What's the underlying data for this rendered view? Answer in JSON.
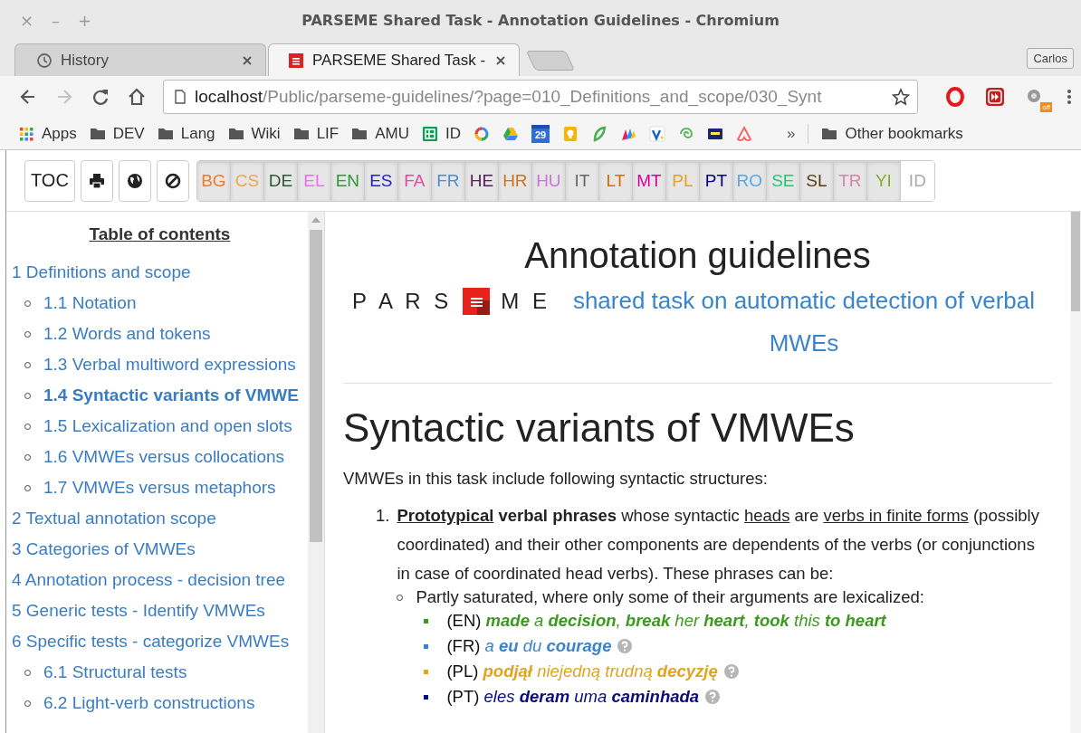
{
  "window": {
    "title": "PARSEME Shared Task - Annotation Guidelines - Chromium",
    "controls": [
      "×",
      "–",
      "+"
    ]
  },
  "tabs": [
    {
      "label": "History",
      "kind": "history",
      "selected": false
    },
    {
      "label": "PARSEME Shared Task -",
      "kind": "page",
      "selected": true
    }
  ],
  "profile": "Carlos",
  "nav_buttons": [
    {
      "kind": "back"
    },
    {
      "kind": "forward",
      "disabled": true
    },
    {
      "kind": "reload"
    },
    {
      "kind": "home"
    }
  ],
  "address": {
    "host": "localhost",
    "path": "/Public/parseme-guidelines/?page=010_Definitions_and_scope/030_Synt"
  },
  "extensions": [
    {
      "kind": "opera"
    },
    {
      "kind": "video"
    },
    {
      "kind": "plugin",
      "badge": "off"
    }
  ],
  "bookmarks": [
    {
      "kind": "apps",
      "label": "Apps"
    },
    {
      "kind": "folder",
      "label": "DEV"
    },
    {
      "kind": "folder",
      "label": "Lang"
    },
    {
      "kind": "folder",
      "label": "Wiki"
    },
    {
      "kind": "folder",
      "label": "LIF"
    },
    {
      "kind": "folder",
      "label": "AMU"
    },
    {
      "kind": "sheet",
      "label": "ID"
    },
    {
      "kind": "icon"
    },
    {
      "kind": "icon"
    },
    {
      "kind": "calendar",
      "label": "29"
    },
    {
      "kind": "icon"
    },
    {
      "kind": "icon"
    },
    {
      "kind": "icon"
    },
    {
      "kind": "icon"
    },
    {
      "kind": "icon"
    },
    {
      "kind": "icon"
    },
    {
      "kind": "icon"
    },
    {
      "kind": "more",
      "label": "»"
    }
  ],
  "other_bookmarks": "Other bookmarks",
  "tool_buttons": [
    {
      "kind": "text",
      "label": "TOC"
    },
    {
      "kind": "print"
    },
    {
      "kind": "globe"
    },
    {
      "kind": "ban"
    }
  ],
  "languages": [
    {
      "code": "BG",
      "color": "#f07a28",
      "selected": true
    },
    {
      "code": "CS",
      "color": "#f4a451",
      "selected": true
    },
    {
      "code": "DE",
      "color": "#2d5a33",
      "selected": true
    },
    {
      "code": "EL",
      "color": "#f06cf0",
      "selected": true
    },
    {
      "code": "EN",
      "color": "#2f9a2f",
      "selected": true
    },
    {
      "code": "ES",
      "color": "#2222c8",
      "selected": true
    },
    {
      "code": "FA",
      "color": "#f0449c",
      "selected": true
    },
    {
      "code": "FR",
      "color": "#4a90d0",
      "selected": true
    },
    {
      "code": "HE",
      "color": "#5a1a5a",
      "selected": true
    },
    {
      "code": "HR",
      "color": "#d07514",
      "selected": true
    },
    {
      "code": "HU",
      "color": "#c878d8",
      "selected": true
    },
    {
      "code": "IT",
      "color": "#666666",
      "selected": true
    },
    {
      "code": "LT",
      "color": "#d86a06",
      "selected": true
    },
    {
      "code": "MT",
      "color": "#d600a0",
      "selected": true
    },
    {
      "code": "PL",
      "color": "#e0a428",
      "selected": true
    },
    {
      "code": "PT",
      "color": "#000080",
      "selected": true
    },
    {
      "code": "RO",
      "color": "#58a8e8",
      "selected": true
    },
    {
      "code": "SE",
      "color": "#22c878",
      "selected": true
    },
    {
      "code": "SL",
      "color": "#5a3c10",
      "selected": true
    },
    {
      "code": "TR",
      "color": "#d884a8",
      "selected": true
    },
    {
      "code": "YI",
      "color": "#86a824",
      "selected": true
    },
    {
      "code": "ID",
      "color": "#aaaaaa",
      "selected": false
    }
  ],
  "toc": {
    "title": "Table of contents",
    "items": [
      {
        "label": "1 Definitions and scope",
        "selected": false,
        "children": [
          {
            "label": "1.1 Notation",
            "selected": false
          },
          {
            "label": "1.2 Words and tokens",
            "selected": false
          },
          {
            "label": "1.3 Verbal multiword expressions",
            "selected": false
          },
          {
            "label": "1.4 Syntactic variants of VMWE",
            "selected": true
          },
          {
            "label": "1.5 Lexicalization and open slots",
            "selected": false
          },
          {
            "label": "1.6 VMWEs versus collocations",
            "selected": false
          },
          {
            "label": "1.7 VMWEs versus metaphors",
            "selected": false
          }
        ]
      },
      {
        "label": "2 Textual annotation scope",
        "selected": false
      },
      {
        "label": "3 Categories of VMWEs",
        "selected": false
      },
      {
        "label": "4 Annotation process - decision tree",
        "selected": false
      },
      {
        "label": "5 Generic tests - Identify VMWEs",
        "selected": false
      },
      {
        "label": "6 Specific tests - categorize VMWEs",
        "selected": false,
        "children": [
          {
            "label": "6.1 Structural tests",
            "selected": false
          },
          {
            "label": "6.2 Light-verb constructions",
            "selected": false
          }
        ]
      }
    ]
  },
  "article": {
    "title": "Annotation guidelines",
    "logo": {
      "left": "P A R S",
      "right": "M E"
    },
    "subtitle_link": "shared task on automatic detection of verbal MWEs",
    "heading": "Syntactic variants of VMWEs",
    "intro": "VMWEs in this task include following syntactic structures:",
    "list": [
      {
        "number": "1.",
        "segments": [
          {
            "text": "Prototypical",
            "kind": "key_term"
          },
          {
            "text": " verbal phrases",
            "kind": "strong"
          },
          {
            "text": " whose syntactic ",
            "kind": "text"
          },
          {
            "text": "heads",
            "kind": "term"
          },
          {
            "text": " are ",
            "kind": "text"
          },
          {
            "text": "verbs in finite forms",
            "kind": "term"
          },
          {
            "text": " (possibly coordinated) and their other components are dependents of the verbs (or conjunctions in case of coordinated head verbs). These phrases can be:",
            "kind": "text"
          }
        ],
        "subitems": [
          {
            "text": "Partly saturated, where only some of their arguments are lexicalized:",
            "examples": [
              {
                "lang": "(EN)",
                "color": "#3a9a1e",
                "text": "**made** a **decision**, **break** her **heart**, **took** this **to heart**",
                "help": false
              },
              {
                "lang": "(FR)",
                "color": "#3a84cc",
                "text": "a **eu** du **courage**",
                "help": true
              },
              {
                "lang": "(PL)",
                "color": "#e0a420",
                "text": "**podjął** niejedną trudną **decyzję**",
                "help": true
              },
              {
                "lang": "(PT)",
                "color": "#0a0a80",
                "text": "eles **deram** uma **caminhada**",
                "help": true
              }
            ]
          }
        ]
      }
    ]
  }
}
